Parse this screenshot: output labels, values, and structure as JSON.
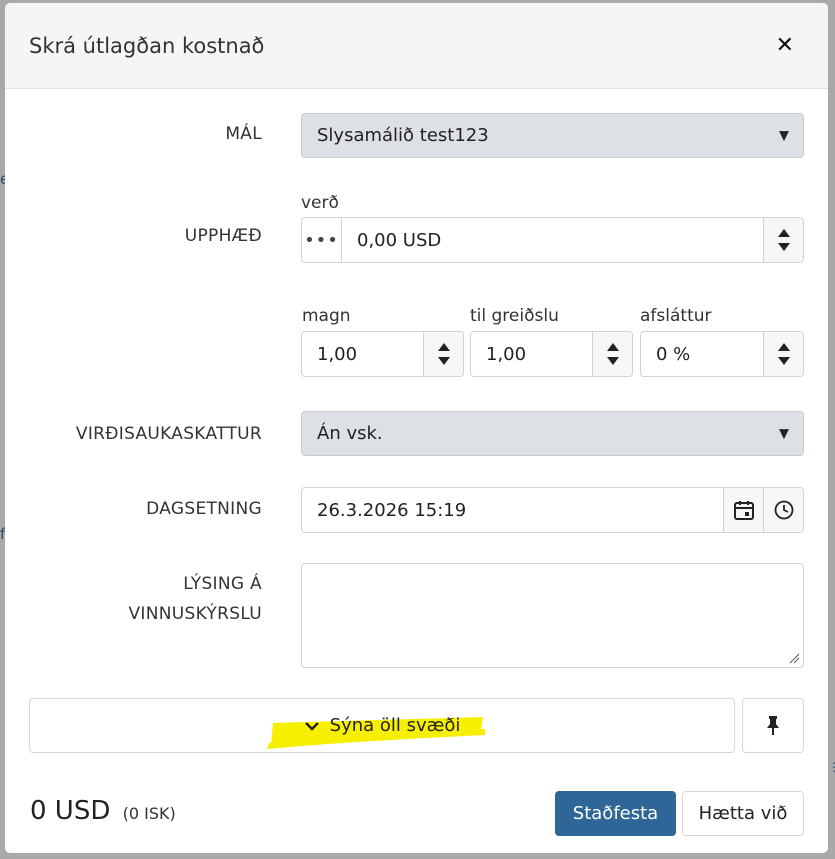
{
  "modal": {
    "title": "Skrá útlagðan kostnað",
    "close_label": "✕"
  },
  "form": {
    "case": {
      "label": "MÁL",
      "value": "Slysamálið test123"
    },
    "amount": {
      "label": "UPPHÆÐ",
      "price_label": "verð",
      "price_value": "0,00 USD",
      "quantity_label": "magn",
      "quantity_value": "1,00",
      "to_pay_label": "til greiðslu",
      "to_pay_value": "1,00",
      "discount_label": "afsláttur",
      "discount_value": "0 %"
    },
    "vat": {
      "label": "VIRÐISAUKASKATTUR",
      "value": "Án vsk."
    },
    "date": {
      "label": "DAGSETNING",
      "value": "26.3.2026 15:19"
    },
    "description": {
      "label_line1": "LÝSING Á",
      "label_line2": "VINNUSKÝRSLU",
      "value": ""
    }
  },
  "show_all": {
    "label": "Sýna öll svæði"
  },
  "footer": {
    "total": "0 USD",
    "total_secondary": "(0 ISK)",
    "confirm_label": "Staðfesta",
    "cancel_label": "Hætta við"
  },
  "colors": {
    "primary": "#2e6797",
    "highlight": "#f7ef00",
    "select_bg": "#dde0e4"
  }
}
